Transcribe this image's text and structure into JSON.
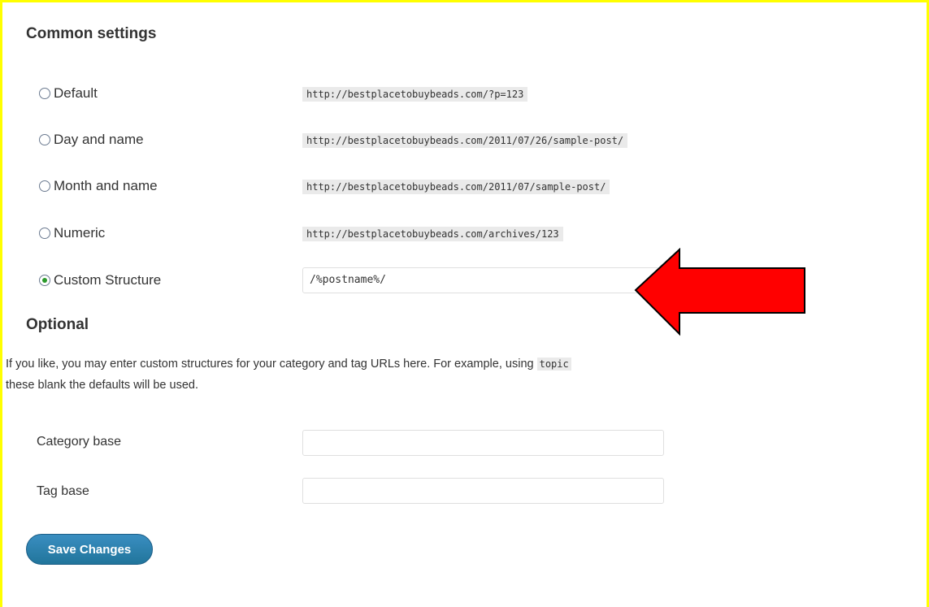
{
  "sections": {
    "common_title": "Common settings",
    "optional_title": "Optional"
  },
  "options": [
    {
      "label": "Default",
      "example": "http://bestplacetobuybeads.com/?p=123"
    },
    {
      "label": "Day and name",
      "example": "http://bestplacetobuybeads.com/2011/07/26/sample-post/"
    },
    {
      "label": "Month and name",
      "example": "http://bestplacetobuybeads.com/2011/07/sample-post/"
    },
    {
      "label": "Numeric",
      "example": "http://bestplacetobuybeads.com/archives/123"
    },
    {
      "label": "Custom Structure",
      "value": "/%postname%/",
      "checked": true
    }
  ],
  "optional_text": {
    "line1": "If you like, you may enter custom structures for your category and tag URLs here. For example, using ",
    "code": "topic",
    "line2": "these blank the defaults will be used."
  },
  "fields": {
    "category_label": "Category base",
    "category_value": "",
    "tag_label": "Tag base",
    "tag_value": ""
  },
  "save_label": "Save Changes",
  "annotation": {
    "arrow_color": "#ff0000",
    "border_color": "#ffff00"
  }
}
